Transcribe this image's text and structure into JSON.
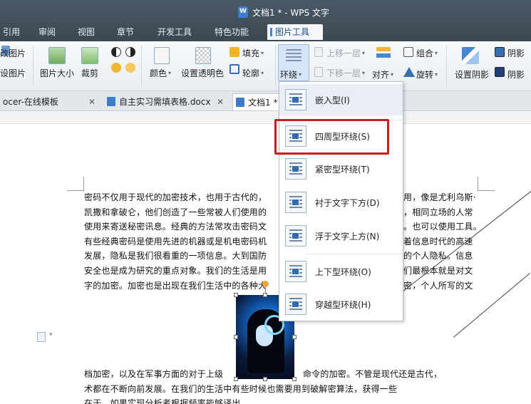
{
  "window": {
    "title": "文档1 * - WPS 文字"
  },
  "menu_tabs": [
    "引用",
    "审阅",
    "视图",
    "章节",
    "开发工具",
    "特色功能",
    "图片工具"
  ],
  "ribbon": {
    "change_picture": "改图片",
    "set_picture": "设图片",
    "picture_size": "图片大小",
    "crop": "裁剪",
    "color": "颜色",
    "set_transparent": "设置透明色",
    "fill": "填充",
    "outline": "轮廓",
    "wrap": "环绕",
    "bring_forward": "上移一层",
    "send_backward": "下移一层",
    "group": "组合",
    "align": "对齐",
    "rotate": "旋转",
    "set_shadow": "设置阴影",
    "shadow1": "阴影",
    "shadow2": "阴影"
  },
  "doc_tabs": [
    {
      "label": "ocer-在线模板"
    },
    {
      "label": "自主实习需填表格.docx"
    },
    {
      "label": "文档1 *"
    }
  ],
  "wrap_menu": [
    {
      "label": "嵌入型(I)"
    },
    {
      "label": "四周型环绕(S)"
    },
    {
      "label": "紧密型环绕(T)"
    },
    {
      "label": "衬于文字下方(D)"
    },
    {
      "label": "浮于文字上方(N)"
    },
    {
      "label": "上下型环绕(O)"
    },
    {
      "label": "穿越型环绕(H)"
    }
  ],
  "document": {
    "para1": [
      "密码不仅用于现代的加密技术，也用于古代的，",
      "凯撒和拿破仑，他们创造了一些常被人们使用的",
      "使用来寄送秘密讯息。经典的方法常攻击密码文",
      "有些经典密码是使用先进的机器或是机电密码机",
      "发展，隐私是我们很看重的一项信息。大到国防",
      "安全也是成为研究的重点对象。我们的生活是用",
      "字的加密。加密也是出现在我们生活中的各种大"
    ],
    "para1_right": [
      "用，像是尤利乌斯·",
      "，相同立场的人常",
      "。也可以使用工具。",
      "着信息时代的高速",
      "的个人隐私。信息",
      "们最根本就是对文",
      "密，个人所写的文"
    ],
    "para2": [
      "档加密，以及在军事方面的对于上级",
      "术都在不断向前发展。在我们的生活中有些时候也需要用到破解密算法，获得一些",
      "在于。如果实现分析者根据频率能够译出"
    ],
    "para2_right": [
      "命令的加密。不管是现代还是古代，"
    ]
  }
}
